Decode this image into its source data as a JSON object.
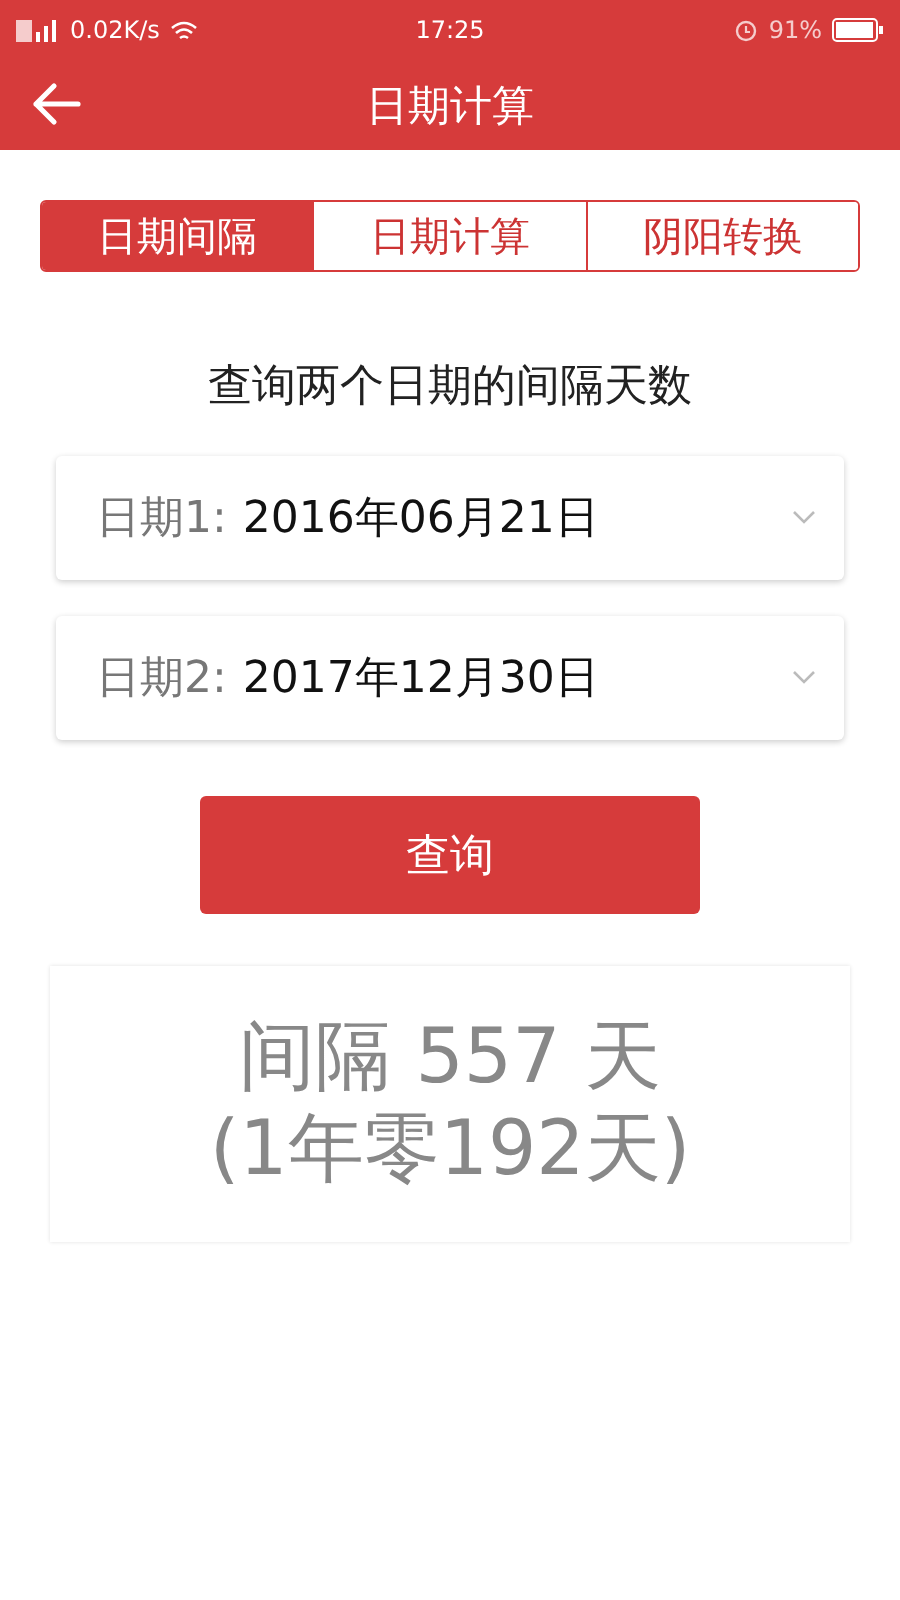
{
  "status_bar": {
    "speed": "0.02K/s",
    "time": "17:25",
    "battery": "91%"
  },
  "header": {
    "title": "日期计算"
  },
  "tabs": [
    {
      "label": "日期间隔",
      "selected": true
    },
    {
      "label": "日期计算",
      "selected": false
    },
    {
      "label": "阴阳转换",
      "selected": false
    }
  ],
  "subtitle": "查询两个日期的间隔天数",
  "dates": [
    {
      "label": "日期1:",
      "value": "2016年06月21日"
    },
    {
      "label": "日期2:",
      "value": "2017年12月30日"
    }
  ],
  "query_button": "查询",
  "result": {
    "interval": "间隔 557 天",
    "detail": "(1年零192天)"
  }
}
